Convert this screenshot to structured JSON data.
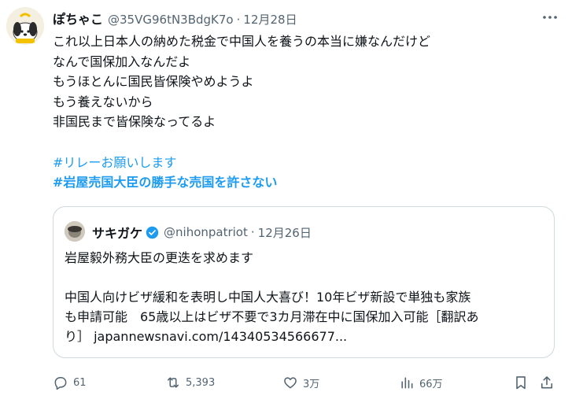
{
  "tweet": {
    "display_name": "ぽちゃこ",
    "handle": "@35VG96tN3BdgK7o",
    "separator": "·",
    "date": "12月28日",
    "avatar_badge_text": "Pochacco",
    "lines": [
      "これ以上日本人の納めた税金で中国人を養うの本当に嫌なんだけど",
      "なんで国保加入なんだよ",
      "もうほとんに国民皆保険やめようよ",
      "もう養えないから",
      "非国民まで皆保険なってるよ"
    ],
    "hashtags": [
      "#リレーお願いします",
      "#岩屋売国大臣の勝手な売国を許さない"
    ]
  },
  "quote": {
    "display_name": "サキガケ",
    "handle": "@nihonpatriot",
    "separator": "·",
    "date": "12月26日",
    "lines_first": [
      "岩屋毅外務大臣の更迭を求めます"
    ],
    "lines_second": [
      "中国人向けビザ緩和を表明し中国人大喜び！10年ビザ新設で単独も家族",
      "も申請可能　65歳以上はビザ不要で3カ月滞在中に国保加入可能［翻訳あ",
      "り］ japannewsnavi.com/14340534566677..."
    ]
  },
  "actions": {
    "reply": {
      "icon": "reply-icon",
      "count": "61"
    },
    "retweet": {
      "icon": "retweet-icon",
      "count": "5,393"
    },
    "like": {
      "icon": "heart-icon",
      "count": "3万"
    },
    "views": {
      "icon": "views-icon",
      "count": "66万"
    },
    "bookmark": {
      "icon": "bookmark-icon"
    },
    "share": {
      "icon": "share-icon"
    }
  },
  "colors": {
    "text": "#0f1419",
    "secondary": "#536471",
    "link": "#1d9bf0",
    "border": "#cfd9de",
    "verified": "#1d9bf0"
  }
}
